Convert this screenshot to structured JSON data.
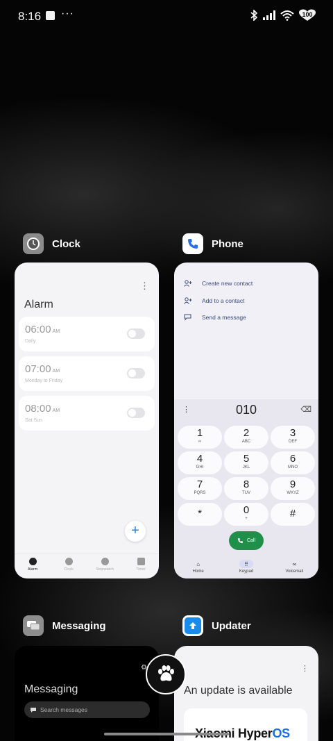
{
  "status": {
    "time": "8:16",
    "more": "···",
    "battery": "100"
  },
  "cards": {
    "clock": {
      "app_name": "Clock",
      "title": "Alarm",
      "alarms": [
        {
          "time": "06:00",
          "ampm": "AM",
          "repeat": "Daily",
          "enabled": false
        },
        {
          "time": "07:00",
          "ampm": "AM",
          "repeat": "Monday to Friday",
          "enabled": false
        },
        {
          "time": "08:00",
          "ampm": "AM",
          "repeat": "Sat Sun",
          "enabled": false
        }
      ],
      "nav": [
        {
          "label": "Alarm",
          "active": true
        },
        {
          "label": "Clock",
          "active": false
        },
        {
          "label": "Stopwatch",
          "active": false
        },
        {
          "label": "Timer",
          "active": false
        }
      ]
    },
    "phone": {
      "app_name": "Phone",
      "options": [
        "Create new contact",
        "Add to a contact",
        "Send a message"
      ],
      "dialed_number": "010",
      "keys": [
        {
          "digit": "1",
          "letters": "∞"
        },
        {
          "digit": "2",
          "letters": "ABC"
        },
        {
          "digit": "3",
          "letters": "DEF"
        },
        {
          "digit": "4",
          "letters": "GHI"
        },
        {
          "digit": "5",
          "letters": "JKL"
        },
        {
          "digit": "6",
          "letters": "MNO"
        },
        {
          "digit": "7",
          "letters": "PQRS"
        },
        {
          "digit": "8",
          "letters": "TUV"
        },
        {
          "digit": "9",
          "letters": "WXYZ"
        },
        {
          "digit": "*",
          "letters": ""
        },
        {
          "digit": "0",
          "letters": "+"
        },
        {
          "digit": "#",
          "letters": ""
        }
      ],
      "call_label": "Call",
      "nav": [
        {
          "label": "Home",
          "active": false
        },
        {
          "label": "Keypad",
          "active": true
        },
        {
          "label": "Voicemail",
          "active": false
        }
      ]
    },
    "messaging": {
      "app_name": "Messaging",
      "title": "Messaging",
      "search_placeholder": "Search messages"
    },
    "updater": {
      "app_name": "Updater",
      "title": "An update is available",
      "brand_main": "Xiaomi Hyper",
      "brand_os": "OS"
    }
  },
  "colors": {
    "accent_blue": "#2b7de9",
    "call_green": "#1f8f4a",
    "updater_icon": "#1a8be8"
  }
}
